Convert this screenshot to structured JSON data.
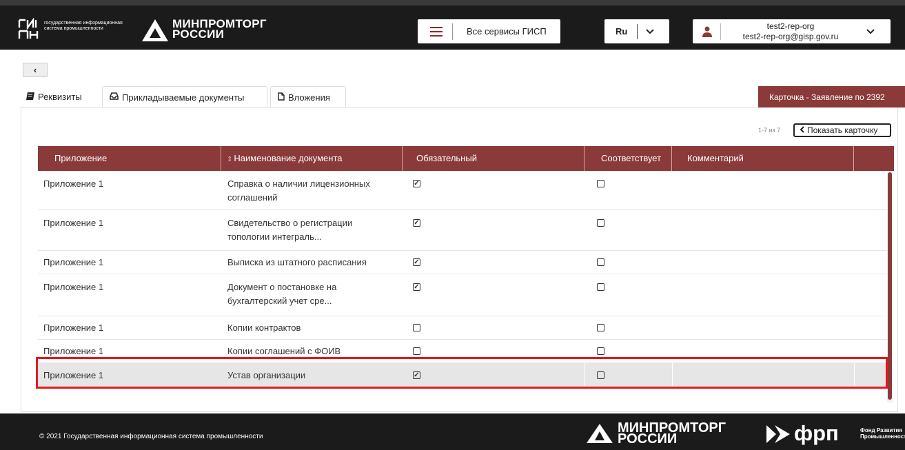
{
  "header": {
    "gisp_logo_text": "ГИСП",
    "gisp_caption": "государственная информационная система промышленности",
    "ministry_logo_line1": "МИНПРОМТОРГ",
    "ministry_logo_line2": "РОССИИ",
    "services_label": "Все сервисы ГИСП",
    "language": "Ru",
    "user_name": "test2-rep-org",
    "user_email": "test2-rep-org@gisp.gov.ru"
  },
  "nav": {
    "back_label": "‹"
  },
  "tabs": [
    {
      "icon": "book-icon",
      "label": "Реквизиты"
    },
    {
      "icon": "inbox-icon",
      "label": "Прикладываемые документы"
    },
    {
      "icon": "file-icon",
      "label": "Вложения"
    }
  ],
  "card_badge": "Карточка - Заявление по 2392",
  "pager": {
    "info": "1-7 из 7",
    "show_card_label": "Показать карточку"
  },
  "table": {
    "columns": [
      "Приложение",
      "Наименование документа",
      "Обязательный",
      "Соответствует",
      "Комментарий"
    ],
    "rows": [
      {
        "app": "Приложение 1",
        "doc_line1": "Справка о наличии лицензионных",
        "doc_line2": "соглашений",
        "mandatory": true,
        "matches": false,
        "comment": ""
      },
      {
        "app": "Приложение 1",
        "doc_line1": "Свидетельство о регистрации",
        "doc_line2": "топологии интеграль...",
        "mandatory": true,
        "matches": false,
        "comment": ""
      },
      {
        "app": "Приложение 1",
        "doc_line1": "Выписка из штатного расписания",
        "doc_line2": "",
        "mandatory": true,
        "matches": false,
        "comment": ""
      },
      {
        "app": "Приложение 1",
        "doc_line1": "Документ о постановке на",
        "doc_line2": "бухгалтерский учет сре...",
        "mandatory": true,
        "matches": false,
        "comment": ""
      },
      {
        "app": "Приложение 1",
        "doc_line1": "Копии контрактов",
        "doc_line2": "",
        "mandatory": false,
        "matches": false,
        "comment": ""
      },
      {
        "app": "Приложение 1",
        "doc_line1": "Копии соглашений с ФОИВ",
        "doc_line2": "",
        "mandatory": false,
        "matches": false,
        "comment": ""
      },
      {
        "app": "Приложение 1",
        "doc_line1": "Устав организации",
        "doc_line2": "",
        "mandatory": true,
        "matches": false,
        "comment": "",
        "selected": true
      }
    ]
  },
  "footer": {
    "copyright": "© 2021 Государственная информационная система промышленности",
    "ministry_line1": "МИНПРОМТОРГ",
    "ministry_line2": "РОССИИ",
    "frp_logo": "фрп",
    "frp_caption_line1": "Фонд Развития",
    "frp_caption_line2": "Промышленности"
  },
  "colors": {
    "accent": "#8b3a3a",
    "header_bg": "#1b1b1b",
    "highlight": "#e5191c"
  }
}
